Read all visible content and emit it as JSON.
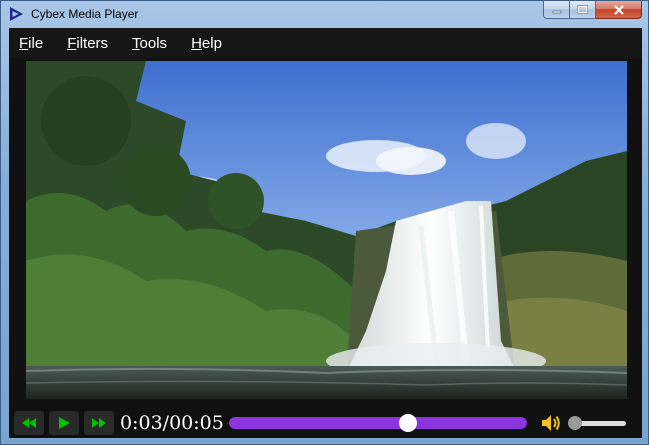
{
  "window": {
    "title": "Cybex Media Player",
    "icon": "play-triangle-icon"
  },
  "menu": {
    "items": [
      {
        "label": "File",
        "mnemonic": "F"
      },
      {
        "label": "Filters",
        "mnemonic": "F"
      },
      {
        "label": "Tools",
        "mnemonic": "T"
      },
      {
        "label": "Help",
        "mnemonic": "H"
      }
    ]
  },
  "player": {
    "time_display": "0:03/00:05",
    "progress": 0.6,
    "volume": 0.1,
    "seek_color": "#8a35e0",
    "button_color": "#00c000"
  }
}
